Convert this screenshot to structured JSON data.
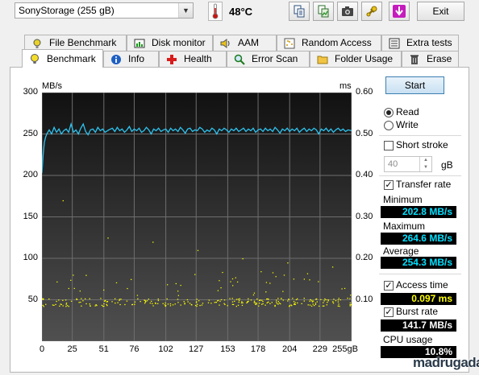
{
  "toolbar": {
    "drive": "SonyStorage (255 gB)",
    "temperature": "48°C",
    "exit_label": "Exit",
    "icons": [
      "copy-text-icon",
      "copy-image-icon",
      "screenshot-camera-icon",
      "options-icon",
      "save-download-icon"
    ]
  },
  "tabs_top": [
    {
      "label": "File Benchmark",
      "icon": "file-icon"
    },
    {
      "label": "Disk monitor",
      "icon": "monitor-chart-icon"
    },
    {
      "label": "AAM",
      "icon": "speaker-icon"
    },
    {
      "label": "Random Access",
      "icon": "scatter-icon"
    },
    {
      "label": "Extra tests",
      "icon": "list-icon"
    }
  ],
  "tabs_bottom": [
    {
      "label": "Benchmark",
      "icon": "bulb-icon",
      "active": true
    },
    {
      "label": "Info",
      "icon": "info-icon"
    },
    {
      "label": "Health",
      "icon": "health-cross-icon"
    },
    {
      "label": "Error Scan",
      "icon": "magnifier-icon"
    },
    {
      "label": "Folder Usage",
      "icon": "folder-icon"
    },
    {
      "label": "Erase",
      "icon": "trash-icon"
    }
  ],
  "controls": {
    "start_label": "Start",
    "read_label": "Read",
    "write_label": "Write",
    "mode": "read",
    "short_stroke_label": "Short stroke",
    "short_stroke_checked": false,
    "short_stroke_value": "40",
    "short_stroke_unit": "gB",
    "transfer_rate_label": "Transfer rate",
    "transfer_rate_checked": true,
    "access_time_label": "Access time",
    "access_time_checked": true,
    "burst_rate_label": "Burst rate",
    "burst_rate_checked": true
  },
  "results": {
    "minimum_label": "Minimum",
    "minimum": "202.8 MB/s",
    "maximum_label": "Maximum",
    "maximum": "264.6 MB/s",
    "average_label": "Average",
    "average": "254.3 MB/s",
    "access_time": "0.097 ms",
    "burst_rate": "141.7 MB/s",
    "cpu_usage_label": "CPU usage",
    "cpu_usage": "10.8%"
  },
  "watermark": "madrugada",
  "colors": {
    "transfer_line": "#2ec4f0",
    "access_points": "#ffff00",
    "chart_bg_top": "#111111",
    "chart_bg_bottom": "#505050",
    "grid": "#6e6e6e"
  },
  "chart_data": {
    "type": "line",
    "ylabel_left": "MB/s",
    "ylabel_right": "ms",
    "x_ticks": [
      "0",
      "25",
      "51",
      "76",
      "102",
      "127",
      "153",
      "178",
      "204",
      "229",
      "255gB"
    ],
    "xlim": [
      0,
      255
    ],
    "y_ticks_left": [
      "300",
      "250",
      "200",
      "150",
      "100",
      "50"
    ],
    "ylim_left": [
      0,
      300
    ],
    "y_ticks_right": [
      "0.60",
      "0.50",
      "0.40",
      "0.30",
      "0.20",
      "0.10"
    ],
    "ylim_right": [
      0,
      0.6
    ],
    "series": [
      {
        "name": "Transfer rate",
        "axis": "left",
        "points": [
          [
            0,
            203
          ],
          [
            1,
            225
          ],
          [
            2,
            240
          ],
          [
            3,
            246
          ],
          [
            4,
            250
          ],
          [
            6,
            255
          ],
          [
            8,
            250
          ],
          [
            10,
            258
          ],
          [
            12,
            252
          ],
          [
            14,
            256
          ],
          [
            16,
            250
          ],
          [
            18,
            254
          ],
          [
            20,
            256
          ],
          [
            22,
            252
          ],
          [
            24,
            262
          ],
          [
            26,
            252
          ],
          [
            28,
            255
          ],
          [
            30,
            250
          ],
          [
            32,
            257
          ],
          [
            34,
            262
          ],
          [
            36,
            253
          ],
          [
            38,
            249
          ],
          [
            40,
            255
          ],
          [
            42,
            256
          ],
          [
            44,
            252
          ],
          [
            46,
            258
          ],
          [
            48,
            254
          ],
          [
            50,
            256
          ],
          [
            52,
            252
          ],
          [
            55,
            255
          ],
          [
            58,
            257
          ],
          [
            60,
            253
          ],
          [
            62,
            258
          ],
          [
            64,
            254
          ],
          [
            66,
            256
          ],
          [
            68,
            252
          ],
          [
            70,
            255
          ],
          [
            72,
            259
          ],
          [
            74,
            253
          ],
          [
            76,
            256
          ],
          [
            78,
            254
          ],
          [
            80,
            257
          ],
          [
            82,
            252
          ],
          [
            84,
            254
          ],
          [
            86,
            258
          ],
          [
            88,
            255
          ],
          [
            90,
            250
          ],
          [
            92,
            256
          ],
          [
            94,
            254
          ],
          [
            96,
            257
          ],
          [
            98,
            253
          ],
          [
            100,
            255
          ],
          [
            102,
            256
          ],
          [
            104,
            252
          ],
          [
            106,
            257
          ],
          [
            108,
            254
          ],
          [
            110,
            256
          ],
          [
            112,
            253
          ],
          [
            114,
            258
          ],
          [
            116,
            255
          ],
          [
            118,
            251
          ],
          [
            120,
            256
          ],
          [
            122,
            257
          ],
          [
            124,
            253
          ],
          [
            126,
            255
          ],
          [
            128,
            254
          ],
          [
            130,
            258
          ],
          [
            132,
            256
          ],
          [
            134,
            252
          ],
          [
            136,
            255
          ],
          [
            138,
            253
          ],
          [
            140,
            257
          ],
          [
            142,
            255
          ],
          [
            144,
            250
          ],
          [
            146,
            256
          ],
          [
            148,
            254
          ],
          [
            150,
            257
          ],
          [
            152,
            255
          ],
          [
            154,
            252
          ],
          [
            156,
            256
          ],
          [
            158,
            254
          ],
          [
            160,
            257
          ],
          [
            162,
            253
          ],
          [
            164,
            255
          ],
          [
            166,
            257
          ],
          [
            168,
            253
          ],
          [
            170,
            256
          ],
          [
            172,
            254
          ],
          [
            174,
            257
          ],
          [
            176,
            252
          ],
          [
            178,
            255
          ],
          [
            180,
            256
          ],
          [
            182,
            253
          ],
          [
            184,
            257
          ],
          [
            186,
            254
          ],
          [
            188,
            256
          ],
          [
            190,
            253
          ],
          [
            192,
            258
          ],
          [
            194,
            255
          ],
          [
            196,
            251
          ],
          [
            198,
            256
          ],
          [
            200,
            254
          ],
          [
            202,
            257
          ],
          [
            204,
            253
          ],
          [
            206,
            256
          ],
          [
            208,
            254
          ],
          [
            210,
            257
          ],
          [
            212,
            252
          ],
          [
            214,
            255
          ],
          [
            216,
            257
          ],
          [
            218,
            253
          ],
          [
            220,
            256
          ],
          [
            222,
            254
          ],
          [
            224,
            257
          ],
          [
            226,
            255
          ],
          [
            228,
            250
          ],
          [
            230,
            256
          ],
          [
            232,
            254
          ],
          [
            234,
            257
          ],
          [
            236,
            253
          ],
          [
            238,
            256
          ],
          [
            240,
            252
          ],
          [
            242,
            255
          ],
          [
            244,
            257
          ],
          [
            246,
            254
          ],
          [
            248,
            256
          ],
          [
            250,
            253
          ],
          [
            252,
            255
          ],
          [
            255,
            254
          ]
        ]
      },
      {
        "name": "Access time",
        "axis": "right",
        "type": "scatter",
        "typical_range_ms": [
          0.085,
          0.105
        ],
        "outliers_ms": [
          0.34,
          0.25,
          0.24,
          0.22,
          0.2,
          0.19,
          0.18,
          0.16,
          0.15,
          0.14,
          0.13,
          0.12
        ],
        "points_per_band": 260
      }
    ]
  }
}
